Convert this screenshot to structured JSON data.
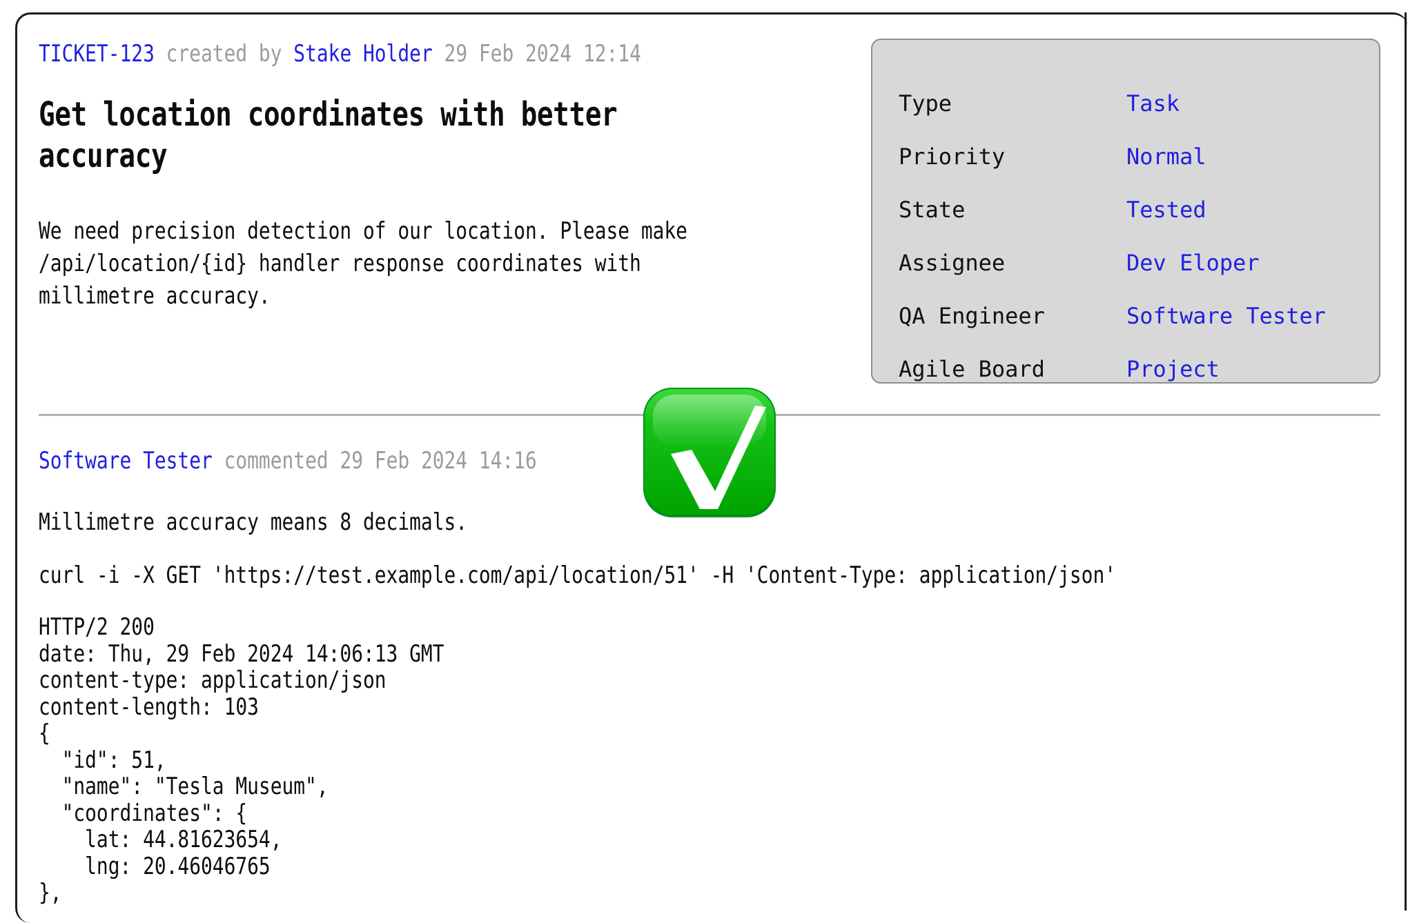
{
  "ticket": {
    "id": "TICKET-123",
    "created_by_label": "created by",
    "author": "Stake Holder",
    "created_at": "29 Feb 2024 12:14",
    "title": "Get location coordinates with better\naccuracy",
    "description": "We need precision detection of our location. Please make\n/api/location/{id} handler response coordinates with\nmillimetre accuracy."
  },
  "info_panel": {
    "rows": [
      {
        "label": "Type",
        "value": "Task"
      },
      {
        "label": "Priority",
        "value": "Normal"
      },
      {
        "label": "State",
        "value": "Tested"
      },
      {
        "label": "Assignee",
        "value": "Dev Eloper"
      },
      {
        "label": "QA Engineer",
        "value": "Software Tester"
      },
      {
        "label": "Agile Board",
        "value": "Project"
      }
    ]
  },
  "comment": {
    "author": "Software Tester",
    "action_label": "commented",
    "timestamp": "29 Feb 2024 14:16",
    "note": "Millimetre accuracy means 8 decimals.",
    "curl": "curl -i -X GET 'https://test.example.com/api/location/51' -H 'Content-Type: application/json'",
    "response": "HTTP/2 200\ndate: Thu, 29 Feb 2024 14:06:13 GMT\ncontent-type: application/json\ncontent-length: 103\n{\n  \"id\": 51,\n  \"name\": \"Tesla Museum\",\n  \"coordinates\": {\n    lat: 44.81623654,\n    lng: 20.46046765\n},",
    "status_icon": "white-heavy-check-mark-emoji"
  },
  "colors": {
    "link": "#1f1fe0",
    "muted": "#9b9b9b",
    "panel_bg": "#d8d8d8",
    "panel_border": "#8e8e8e",
    "divider": "#b4b4b4",
    "check_green_light": "#35d435",
    "check_green_dark": "#00a000"
  }
}
